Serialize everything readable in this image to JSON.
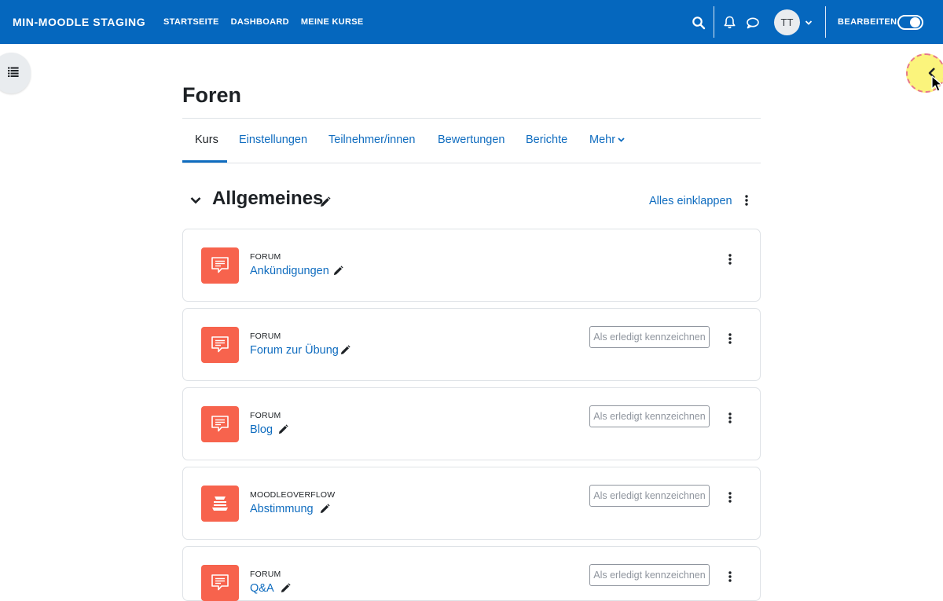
{
  "navbar": {
    "brand": "MIN-MOODLE STAGING",
    "links": [
      "STARTSEITE",
      "DASHBOARD",
      "MEINE KURSE"
    ],
    "avatar_initials": "TT",
    "edit_mode_label": "BEARBEITEN",
    "edit_mode_on": true,
    "background_color": "#0567be"
  },
  "page": {
    "title": "Foren"
  },
  "tabs": {
    "active": "Kurs",
    "items": [
      "Kurs",
      "Einstellungen",
      "Teilnehmer/innen",
      "Bewertungen",
      "Berichte",
      "Mehr"
    ]
  },
  "section": {
    "title": "Allgemeines",
    "collapse_label": "Alles einklappen"
  },
  "activities": [
    {
      "type": "FORUM",
      "name": "Ankündigungen",
      "icon": "forum-icon",
      "completion_button": ""
    },
    {
      "type": "FORUM",
      "name": "Forum zur Übung",
      "icon": "forum-icon",
      "completion_button": "Als erledigt kennzeichnen"
    },
    {
      "type": "FORUM",
      "name": "Blog",
      "icon": "forum-icon",
      "completion_button": "Als erledigt kennzeichnen"
    },
    {
      "type": "MOODLEOVERFLOW",
      "name": "Abstimmung",
      "icon": "moodleoverflow-icon",
      "completion_button": "Als erledigt kennzeichnen"
    },
    {
      "type": "FORUM",
      "name": "Q&A",
      "icon": "forum-icon",
      "completion_button": "Als erledigt kennzeichnen"
    }
  ],
  "colors": {
    "link": "#0f6cbf",
    "activity_icon_bg": "#f7634d",
    "highlight": "#fbf47c"
  }
}
